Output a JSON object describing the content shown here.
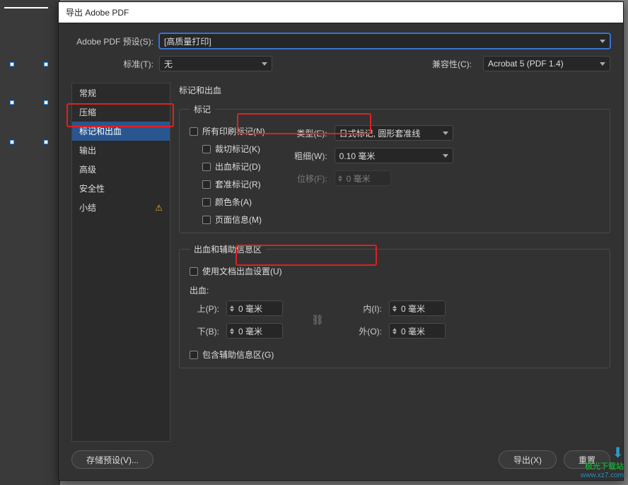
{
  "window": {
    "title": "导出 Adobe PDF"
  },
  "top": {
    "preset_label": "Adobe PDF 预设(S):",
    "preset_value": "[高质量打印]",
    "standard_label": "标准(T):",
    "standard_value": "无",
    "compat_label": "兼容性(C):",
    "compat_value": "Acrobat 5 (PDF 1.4)"
  },
  "sidebar": {
    "items": [
      {
        "label": "常规"
      },
      {
        "label": "压缩"
      },
      {
        "label": "标记和出血"
      },
      {
        "label": "输出"
      },
      {
        "label": "高级"
      },
      {
        "label": "安全性"
      },
      {
        "label": "小结",
        "warn": true
      }
    ],
    "selected_index": 2
  },
  "content": {
    "title": "标记和出血",
    "marks_legend": "标记",
    "bleed_legend": "出血和辅助信息区",
    "all_marks": "所有印刷标记(N)",
    "crop": "裁切标记(K)",
    "bleedm": "出血标记(D)",
    "reg": "套准标记(R)",
    "colorbar": "颜色条(A)",
    "pageinfo": "页面信息(M)",
    "type_label": "类型(E):",
    "type_value": "日式标记, 圆形套准线",
    "weight_label": "粗细(W):",
    "weight_value": "0.10 毫米",
    "offset_label": "位移(F):",
    "offset_value": "0 毫米",
    "use_doc_bleed": "使用文档出血设置(U)",
    "bleed_heading": "出血:",
    "top_label": "上(P):",
    "bottom_label": "下(B):",
    "inner_label": "内(I):",
    "outer_label": "外(O):",
    "bleed_val": "0 毫米",
    "slug": "包含辅助信息区(G)"
  },
  "footer": {
    "save_preset": "存储预设(V)...",
    "export": "导出(X)",
    "reset": "重置"
  },
  "watermark": {
    "line1": "极光下载站",
    "line2": "www.xz7.com"
  }
}
